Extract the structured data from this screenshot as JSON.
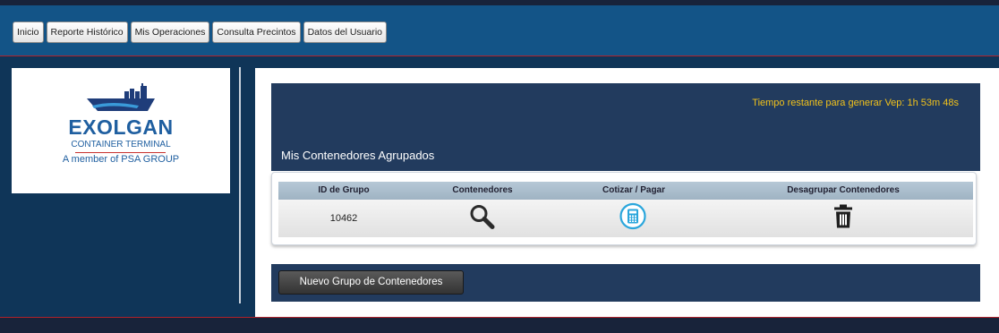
{
  "nav": {
    "items": [
      {
        "label": "Inicio"
      },
      {
        "label": "Reporte Histórico"
      },
      {
        "label": "Mis Operaciones"
      },
      {
        "label": "Consulta Precintos"
      },
      {
        "label": "Datos del Usuario"
      }
    ]
  },
  "logo": {
    "name": "EXOLGAN",
    "subtitle": "CONTAINER TERMINAL",
    "tagline": "A member of PSA GROUP"
  },
  "panel": {
    "timer_text": "Tiempo restante para generar Vep: 1h 53m 48s",
    "title": "Mis Contenedores Agrupados"
  },
  "table": {
    "headers": [
      "ID de Grupo",
      "Contenedores",
      "Cotizar / Pagar",
      "Desagrupar Contenedores"
    ],
    "rows": [
      {
        "id": "10462",
        "view_icon": "magnifier-icon",
        "quote_icon": "calculator-icon",
        "delete_icon": "trash-icon"
      }
    ]
  },
  "actions": {
    "new_group_label": "Nuevo Grupo de Contenedores"
  },
  "colors": {
    "page_bg": "#0f3558",
    "navbar": "#135487",
    "panel": "#223b5e",
    "timer": "#f2c21b",
    "accent_red": "#b0222a",
    "calc_icon": "#2aa6dc"
  }
}
